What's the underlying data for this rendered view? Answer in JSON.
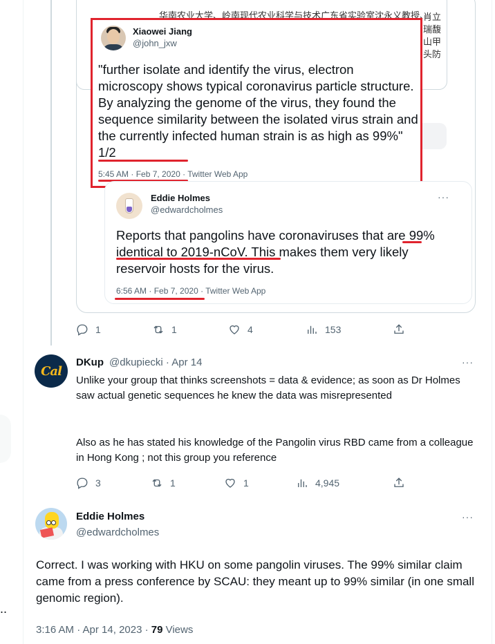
{
  "context_snippet": {
    "top_line": "华南农业大学、岭南现代农业科学与技术广东省实验室沈永义教授、",
    "side_lines": [
      "肖立",
      "瑞馥",
      "山甲",
      "头防"
    ]
  },
  "quoted_tweet": {
    "name": "Xiaowei Jiang",
    "handle": "@john_jxw",
    "text": "\"further isolate and identify the virus, electron microscopy shows typical coronavirus particle structure. By analyzing the genome of the virus, they found the sequence similarity between the isolated virus strain and the currently infected human strain is as high as 99%\" 1/2",
    "time": "5:45 AM · Feb 7, 2020",
    "source": " · Twitter Web App"
  },
  "reply_in_quote": {
    "name": "Eddie Holmes",
    "handle": "@edwardcholmes",
    "text": "Reports that pangolins have coronaviruses that are 99% identical to 2019-nCoV. This makes them very likely reservoir hosts for the virus.",
    "time": "6:56 AM · Feb 7, 2020",
    "source": " · Twitter Web App",
    "more": "···"
  },
  "thread_actions": {
    "replies": "1",
    "retweets": "1",
    "likes": "4",
    "views": "153"
  },
  "reply_tweet": {
    "avatar_text": "Cal",
    "name": "DKup",
    "handle": "@dkupiecki",
    "date": " · Apr 14",
    "more": "···",
    "para1": "Unlike your group that thinks screenshots = data & evidence; as soon as Dr Holmes saw actual genetic sequences he knew the data was misrepresented",
    "para2": "Also as he has stated his knowledge of the Pangolin virus RBD came from a colleague in Hong Kong ; not this group you reference",
    "replies": "3",
    "retweets": "1",
    "likes": "1",
    "views": "4,945"
  },
  "main_tweet": {
    "name": "Eddie Holmes",
    "handle": "@edwardcholmes",
    "more": "···",
    "text": "Correct. I was working with HKU on some pangolin viruses. The 99% similar claim came from a press conference by SCAU: they meant up to 99% similar (in one small genomic region).",
    "time": "3:16 AM · Apr 14, 2023 · ",
    "views_count": "79",
    "views_label": " Views"
  },
  "left_ellipsis": "..",
  "colors": {
    "highlight": "#e0232d",
    "muted": "#536471",
    "border": "#cfd9de"
  },
  "icons": [
    "reply-icon",
    "retweet-icon",
    "like-icon",
    "views-icon",
    "share-icon",
    "more-icon"
  ]
}
